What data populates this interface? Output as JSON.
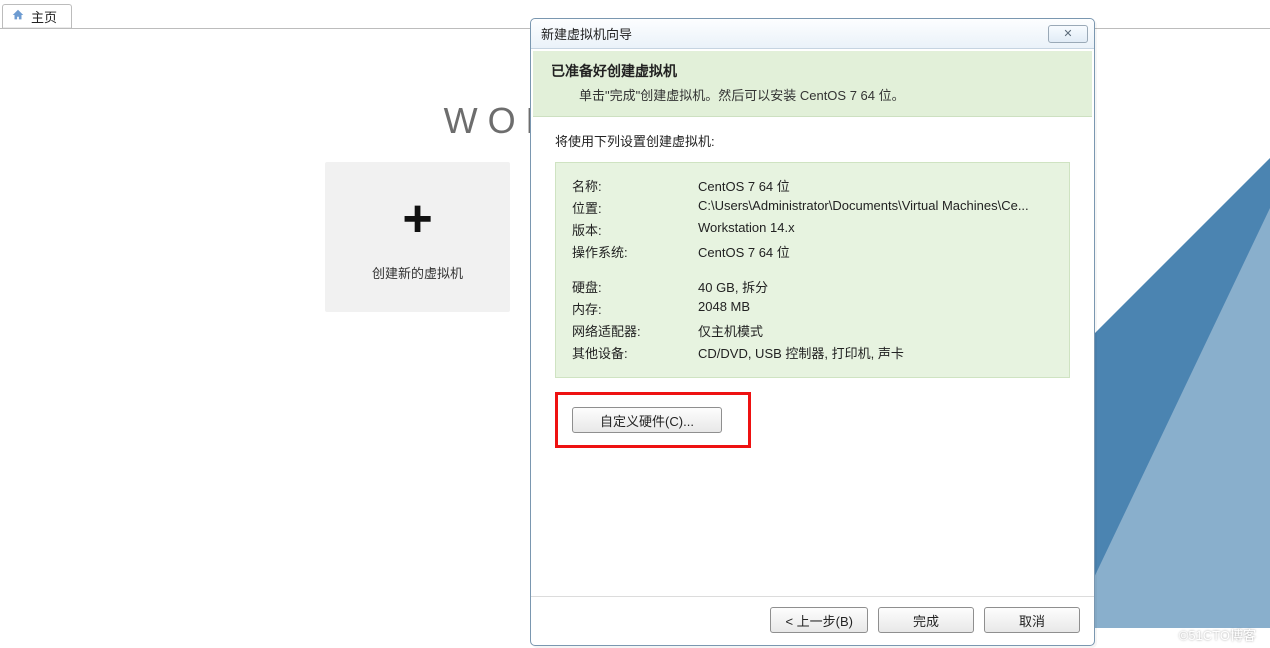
{
  "tab": {
    "label": "主页"
  },
  "brand": "WORKSTATION",
  "tile": {
    "label": "创建新的虚拟机"
  },
  "dialog": {
    "title": "新建虚拟机向导",
    "banner_title": "已准备好创建虚拟机",
    "banner_sub": "单击\"完成\"创建虚拟机。然后可以安装 CentOS 7 64 位。",
    "lead": "将使用下列设置创建虚拟机:",
    "rows": {
      "name_label": "名称:",
      "name_value": "CentOS 7 64 位",
      "loc_label": "位置:",
      "loc_value": "C:\\Users\\Administrator\\Documents\\Virtual Machines\\Ce...",
      "ver_label": "版本:",
      "ver_value": "Workstation 14.x",
      "os_label": "操作系统:",
      "os_value": "CentOS 7 64 位",
      "disk_label": "硬盘:",
      "disk_value": "40 GB, 拆分",
      "mem_label": "内存:",
      "mem_value": "2048 MB",
      "net_label": "网络适配器:",
      "net_value": "仅主机模式",
      "other_label": "其他设备:",
      "other_value": "CD/DVD, USB 控制器, 打印机, 声卡"
    },
    "customize_label": "自定义硬件(C)...",
    "back_label": "< 上一步(B)",
    "finish_label": "完成",
    "cancel_label": "取消"
  },
  "watermark": "©51CTO博客"
}
